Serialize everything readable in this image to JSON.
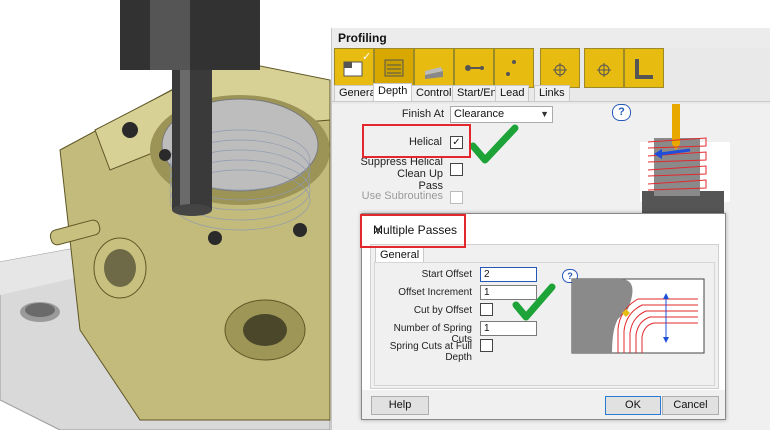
{
  "panel": {
    "title": "Profiling"
  },
  "toolbar": {
    "buttons": [
      "profile-icon",
      "depth-icon",
      "control-icon",
      "start-end-icon",
      "lead-icon",
      "links-icon",
      "target-icon",
      "corner-icon"
    ]
  },
  "tabs": [
    {
      "label": "General"
    },
    {
      "label": "Depth"
    },
    {
      "label": "Control"
    },
    {
      "label": "Start/End"
    },
    {
      "label": "Lead"
    },
    {
      "label": "Links"
    }
  ],
  "depth": {
    "finish_at_label": "Finish At",
    "finish_at_value": "Clearance",
    "helical_label": "Helical",
    "helical_checked": "✓",
    "suppress_label_line1": "Suppress Helical Clean Up",
    "suppress_label_line2": "Pass",
    "use_subroutines_label": "Use Subroutines"
  },
  "help_icon": "?",
  "dialog": {
    "title": "Multiple Passes",
    "close": "✕",
    "tab": "General",
    "start_offset_label": "Start Offset",
    "start_offset_value": "2",
    "offset_increment_label": "Offset Increment",
    "offset_increment_value": "1",
    "cut_by_offset_label": "Cut by Offset",
    "spring_cuts_label": "Number of Spring Cuts",
    "spring_cuts_value": "1",
    "spring_full_depth_label": "Spring Cuts at Full Depth",
    "help_button": "Help",
    "ok_button": "OK",
    "cancel_button": "Cancel"
  },
  "colors": {
    "accent_yellow": "#e8bb11",
    "annotation_red": "#e2282d",
    "check_green": "#1ea338"
  }
}
